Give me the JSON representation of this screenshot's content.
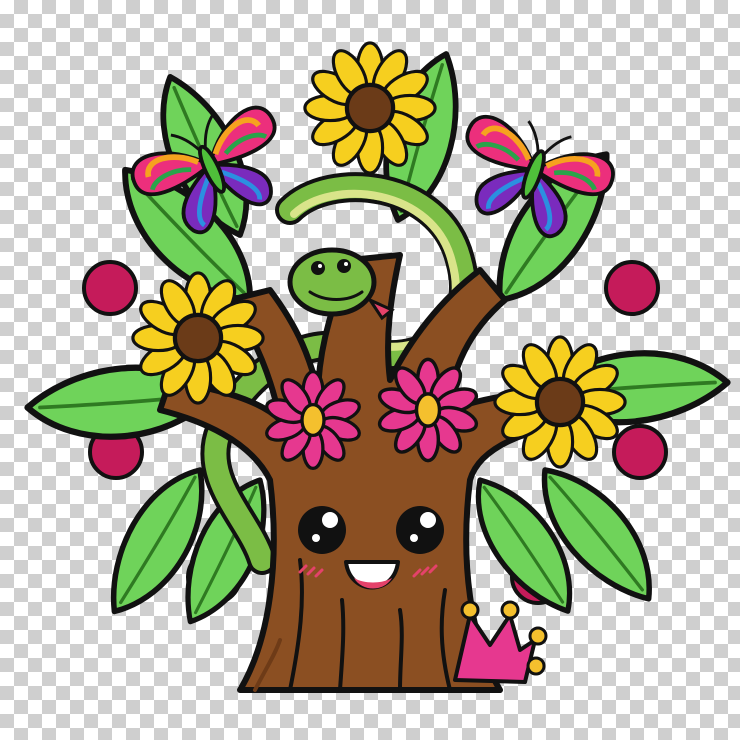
{
  "scene": {
    "subject": "cartoon-tree-character",
    "background": "transparency-checkerboard",
    "colors": {
      "trunk": "#8b4f22",
      "trunk_shadow": "#6e3b17",
      "leaf": "#6fd35a",
      "leaf_vein": "#2f7a22",
      "sunflower_petal": "#f6cf1f",
      "sunflower_center": "#6b3b18",
      "pink_flower": "#e6388f",
      "pink_flower_center": "#f4c02e",
      "berry": "#c51b5a",
      "snake": "#7bbd45",
      "snake_belly": "#d9e48a",
      "butterfly_wing": "#ec2f7c",
      "blush": "#e4426a",
      "crown": "#e6388f"
    }
  }
}
